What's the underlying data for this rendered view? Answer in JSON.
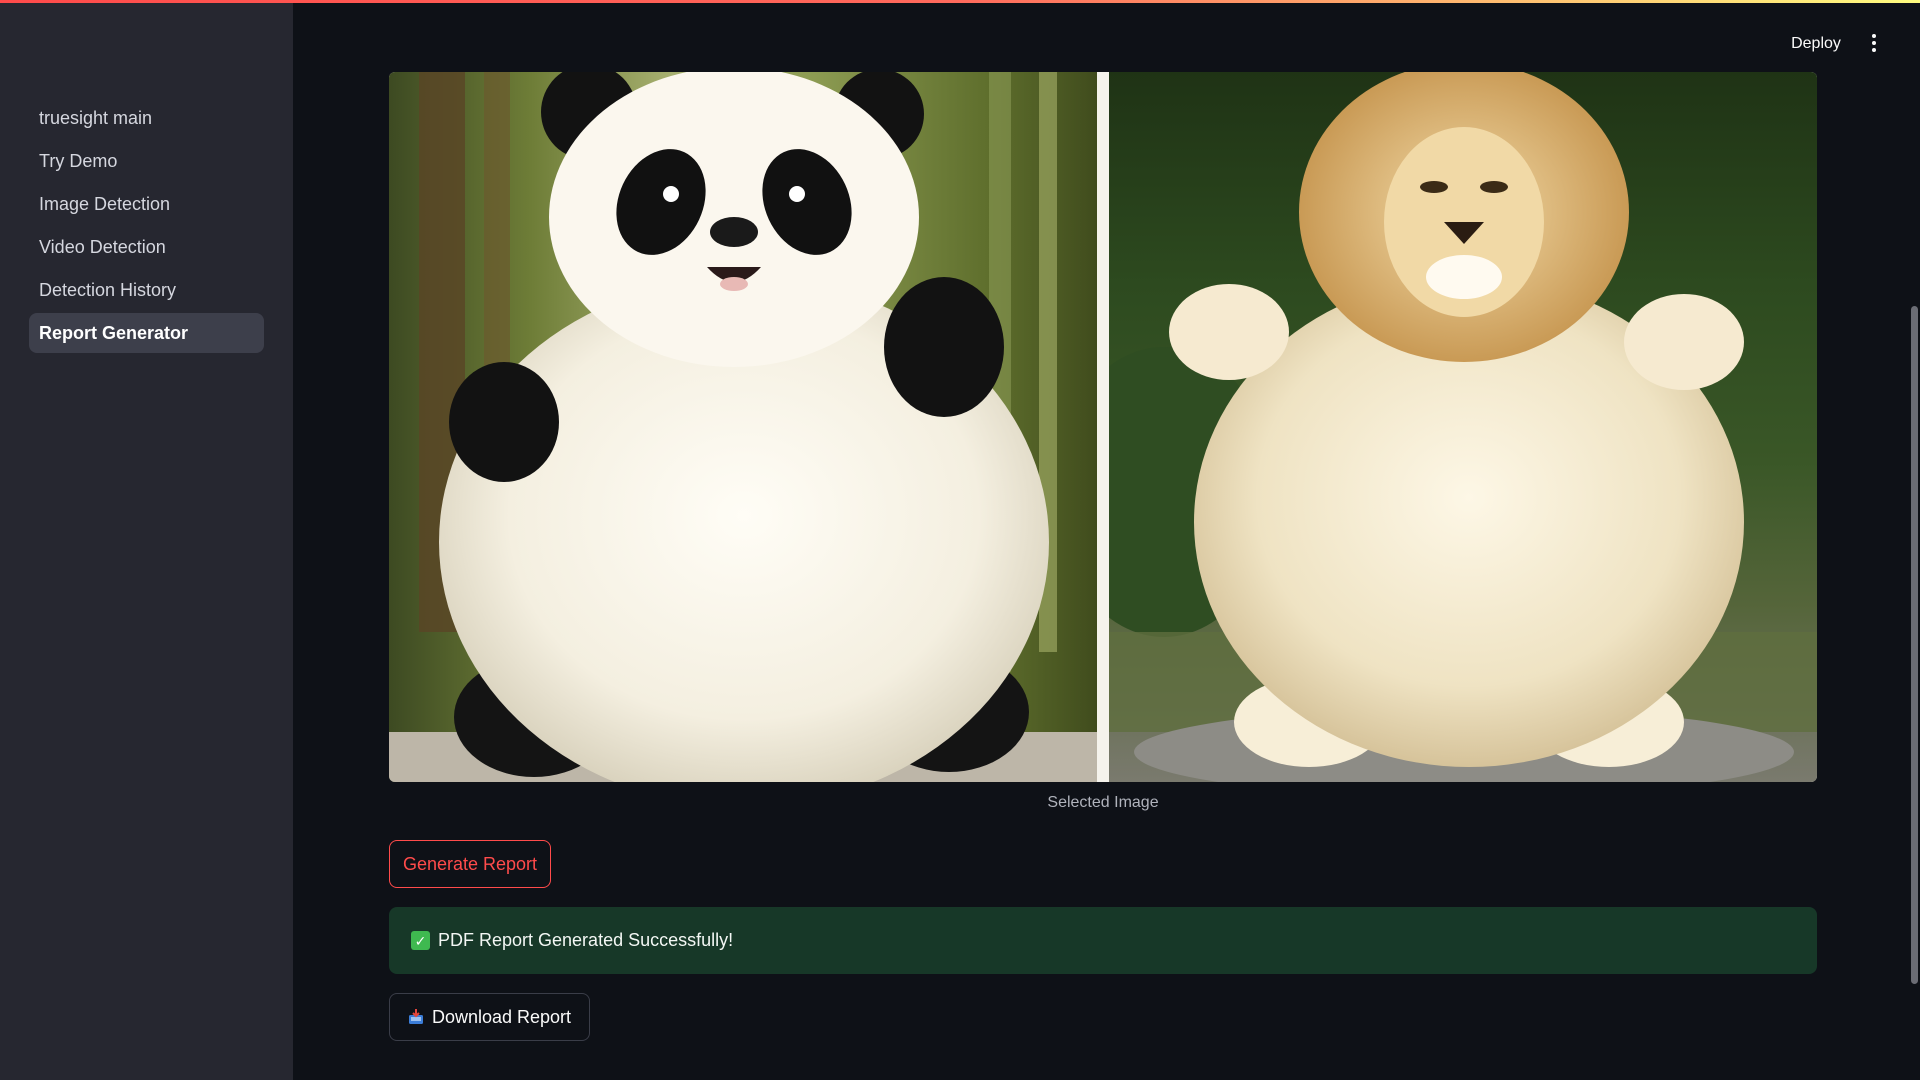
{
  "sidebar": {
    "items": [
      {
        "label": "truesight main",
        "active": false
      },
      {
        "label": "Try Demo",
        "active": false
      },
      {
        "label": "Image Detection",
        "active": false
      },
      {
        "label": "Video Detection",
        "active": false
      },
      {
        "label": "Detection History",
        "active": false
      },
      {
        "label": "Report Generator",
        "active": true
      }
    ]
  },
  "header": {
    "deploy_label": "Deploy",
    "menu_icon": "more-vertical-icon"
  },
  "main": {
    "image": {
      "caption": "Selected Image",
      "panels": [
        "panda",
        "lion"
      ]
    },
    "generate_button_label": "Generate Report",
    "success_message": "PDF Report Generated Successfully!",
    "success_icon": "white-check-mark-icon",
    "download_button_label": "Download Report",
    "download_icon": "inbox-tray-icon"
  },
  "colors": {
    "accent": "#ff4b4b",
    "sidebar_bg": "#262730",
    "app_bg": "#0e1117",
    "success_bg": "#173828"
  }
}
